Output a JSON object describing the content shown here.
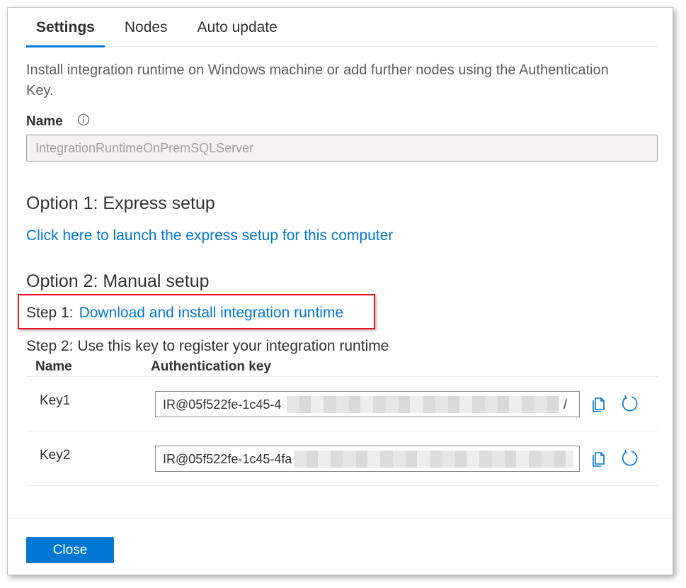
{
  "tabs": [
    {
      "label": "Settings",
      "active": true
    },
    {
      "label": "Nodes",
      "active": false
    },
    {
      "label": "Auto update",
      "active": false
    }
  ],
  "description": "Install integration runtime on Windows machine or add further nodes using the Authentication Key.",
  "name_field": {
    "label": "Name",
    "value": "IntegrationRuntimeOnPremSQLServer",
    "info_icon": "info-icon"
  },
  "option1": {
    "heading": "Option 1: Express setup",
    "link": "Click here to launch the express setup for this computer"
  },
  "option2": {
    "heading": "Option 2: Manual setup",
    "step1_label": "Step 1:",
    "step1_link": "Download and install integration runtime",
    "step2_label": "Step 2: Use this key to register your integration runtime"
  },
  "keys_table": {
    "headers": [
      "Name",
      "Authentication key"
    ],
    "rows": [
      {
        "name": "Key1",
        "key_prefix": "IR@05f522fe-1c45-4",
        "key_suffix": "/"
      },
      {
        "name": "Key2",
        "key_prefix": "IR@05f522fe-1c45-4fa",
        "key_suffix": ""
      }
    ]
  },
  "footer": {
    "close_label": "Close"
  },
  "colors": {
    "accent": "#0078d4",
    "highlight_border": "#e81123"
  }
}
